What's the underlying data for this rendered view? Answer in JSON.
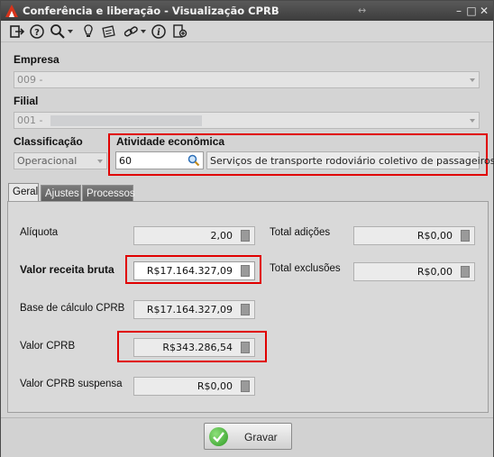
{
  "window": {
    "title": "Conferência e liberação - Visualização CPRB",
    "resize_glyph": "↔",
    "minimize": "–",
    "maximize": "□",
    "close": "✕"
  },
  "toolbar": {
    "icons": [
      "exit-icon",
      "help-icon",
      "search-icon",
      "tip-icon",
      "notes-icon",
      "link-icon",
      "info-icon",
      "attach-icon"
    ]
  },
  "form": {
    "empresa_label": "Empresa",
    "empresa_value": "009 -",
    "filial_label": "Filial",
    "filial_value": "001 -",
    "classificacao_label": "Classificação",
    "classificacao_value": "Operacional",
    "atividade_label": "Atividade econômica",
    "atividade_code": "60",
    "atividade_desc": "Serviços de transporte rodoviário coletivo de passageiros, ..."
  },
  "tabs": [
    {
      "label": "Geral",
      "active": true
    },
    {
      "label": "Ajustes",
      "active": false
    },
    {
      "label": "Processos",
      "active": false
    }
  ],
  "geral": {
    "aliquota_label": "Alíquota",
    "aliquota_value": "2,00",
    "receita_label": "Valor receita bruta",
    "receita_value": "R$17.164.327,09",
    "base_label": "Base de cálculo CPRB",
    "base_value": "R$17.164.327,09",
    "cprb_label": "Valor CPRB",
    "cprb_value": "R$343.286,54",
    "suspensa_label": "Valor CPRB suspensa",
    "suspensa_value": "R$0,00",
    "adicoes_label": "Total adições",
    "adicoes_value": "R$0,00",
    "exclusoes_label": "Total exclusões",
    "exclusoes_value": "R$0,00"
  },
  "footer": {
    "save_label": "Gravar"
  },
  "colors": {
    "highlight": "#e00000",
    "title_bar": "#4a4a4a"
  }
}
